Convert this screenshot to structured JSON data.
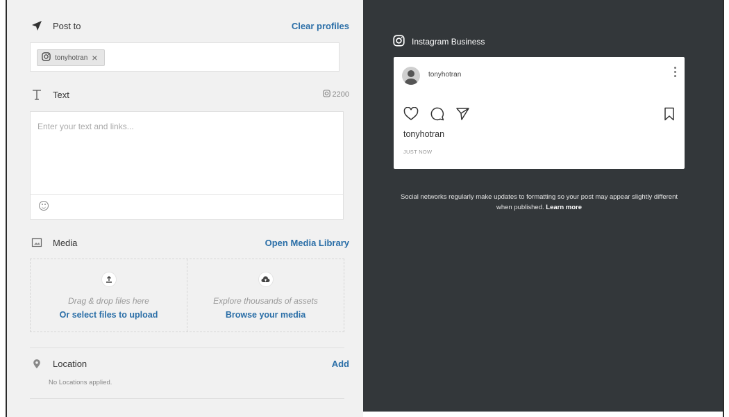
{
  "post_to": {
    "label": "Post to",
    "clear_label": "Clear profiles",
    "profile_chip": {
      "name": "tonyhotran",
      "network_icon": "instagram-icon",
      "remove_icon": "close-icon"
    }
  },
  "text_section": {
    "label": "Text",
    "char_limit": "2200",
    "placeholder": "Enter your text and links...",
    "value": ""
  },
  "media": {
    "label": "Media",
    "open_library_label": "Open Media Library",
    "upload_hint": "Drag & drop files here",
    "upload_action": "Or select files to upload",
    "explore_hint": "Explore thousands of assets",
    "explore_action": "Browse your media"
  },
  "location": {
    "label": "Location",
    "add_label": "Add",
    "empty_text": "No Locations applied."
  },
  "preview": {
    "network_label": "Instagram Business",
    "username": "tonyhotran",
    "caption_username": "tonyhotran",
    "timestamp": "JUST NOW",
    "disclaimer": "Social networks regularly make updates to formatting so your post may appear slightly different when published.",
    "learn_more": "Learn more"
  },
  "colors": {
    "link": "#2a6ea7",
    "left_bg": "#f1f1f1",
    "preview_bg": "#33373a"
  }
}
